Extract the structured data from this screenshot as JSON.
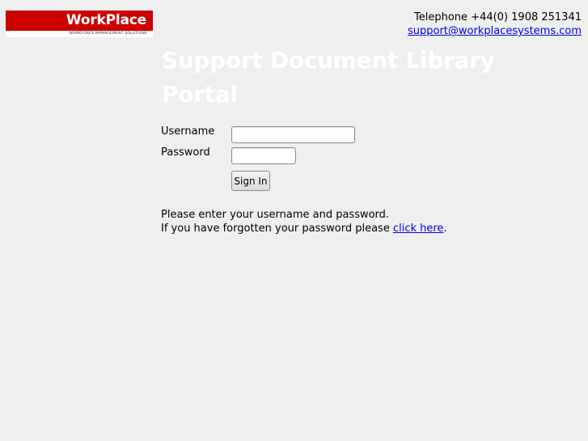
{
  "header": {
    "logo": {
      "wordmark": "WorkPlace",
      "tagline": "WORKFORCE MANAGEMENT SOLUTIONS",
      "brand_color": "#cc0000"
    },
    "contact": {
      "telephone": "Telephone +44(0) 1908 251341",
      "email": "support@workplacesystems.com"
    }
  },
  "main": {
    "title": "Support Document Library Portal",
    "form": {
      "username_label": "Username",
      "username_value": "",
      "password_label": "Password",
      "password_value": "",
      "submit_label": "Sign In"
    },
    "instructions": {
      "line1": "Please enter your username and password.",
      "line2_prefix": "If you have forgotten your password please ",
      "link_text": "click here",
      "line2_suffix": "."
    }
  },
  "colors": {
    "background": "#efefef",
    "title": "#ffffff",
    "link": "#0000ee"
  }
}
